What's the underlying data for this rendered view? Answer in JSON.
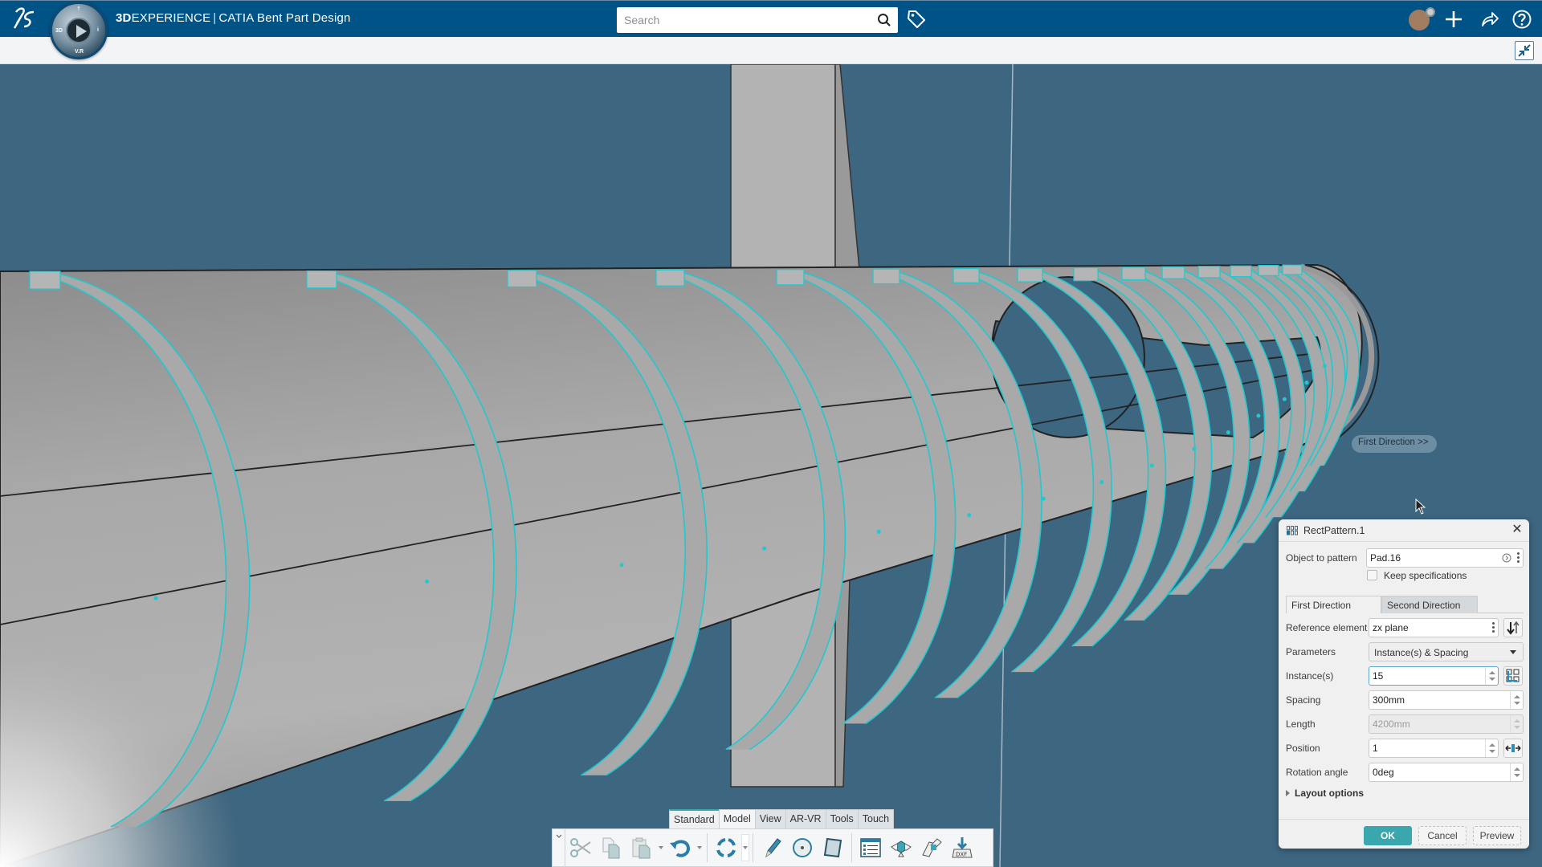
{
  "app": {
    "brand_bold": "3D",
    "brand_rest": "EXPERIENCE",
    "separator": "|",
    "product": "CATIA Bent Part Design",
    "compass_labels": {
      "top": "†",
      "left": "3D",
      "right": "i",
      "bottom": "V.R"
    }
  },
  "topbar": {
    "search_placeholder": "Search",
    "search_value": "",
    "icons": [
      "ds-logo-icon",
      "compass-icon",
      "search-icon",
      "tag-icon",
      "avatar",
      "plus-icon",
      "share-icon",
      "help-icon"
    ]
  },
  "subbar": {
    "icons": [
      "collapse-icon"
    ]
  },
  "viewport": {
    "direction_label": "First Direction >>",
    "colors": {
      "background": "#3d6680",
      "highlight": "#20c8cf",
      "part": "#b0b0b0"
    }
  },
  "dialog": {
    "title": "RectPattern.1",
    "object_to_pattern_label": "Object to pattern",
    "object_to_pattern_value": "Pad.16",
    "keep_specifications_label": "Keep specifications",
    "keep_specifications_checked": false,
    "tabs": [
      {
        "label": "First Direction",
        "active": true
      },
      {
        "label": "Second Direction",
        "active": false
      }
    ],
    "fields": {
      "reference_element_label": "Reference element",
      "reference_element_value": "zx plane",
      "parameters_label": "Parameters",
      "parameters_value": "Instance(s) & Spacing",
      "instances_label": "Instance(s)",
      "instances_value": "15",
      "spacing_label": "Spacing",
      "spacing_value": "300mm",
      "length_label": "Length",
      "length_value": "4200mm",
      "position_label": "Position",
      "position_value": "1",
      "rotation_label": "Rotation angle",
      "rotation_value": "0deg"
    },
    "layout_options_label": "Layout options",
    "buttons": {
      "ok": "OK",
      "cancel": "Cancel",
      "preview": "Preview"
    },
    "accent": "#3aa6ae"
  },
  "action_bar": {
    "tabs": [
      {
        "label": "Standard",
        "active": true
      },
      {
        "label": "Model",
        "active": false
      },
      {
        "label": "View",
        "active": false
      },
      {
        "label": "AR-VR",
        "active": false
      },
      {
        "label": "Tools",
        "active": false
      },
      {
        "label": "Touch",
        "active": false
      }
    ],
    "tools": [
      "cut",
      "copy",
      "paste",
      "undo",
      "update",
      "sketch",
      "hole",
      "plane",
      "table",
      "unfold",
      "fold",
      "export-dxf"
    ]
  }
}
